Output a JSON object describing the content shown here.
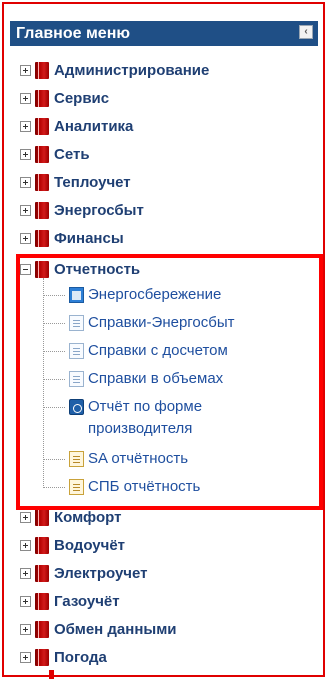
{
  "header": {
    "title": "Главное меню",
    "collapse_glyph": "‹"
  },
  "menu": {
    "items_top": [
      {
        "label": "Администрирование",
        "icon": "book-icon"
      },
      {
        "label": "Сервис",
        "icon": "book-icon"
      },
      {
        "label": "Аналитика",
        "icon": "book-icon"
      },
      {
        "label": "Сеть",
        "icon": "book-icon"
      },
      {
        "label": "Теплоучет",
        "icon": "book-icon"
      },
      {
        "label": "Энергосбыт",
        "icon": "book-icon"
      },
      {
        "label": "Финансы",
        "icon": "book-icon"
      }
    ],
    "expanded": {
      "label": "Отчетность",
      "children": [
        {
          "label": "Энергосбережение",
          "icon": "window-icon"
        },
        {
          "label": "Справки-Энергосбыт",
          "icon": "document-icon"
        },
        {
          "label": "Справки с досчетом",
          "icon": "document-icon"
        },
        {
          "label": "Справки в объемах",
          "icon": "document-icon"
        },
        {
          "label": "Отчёт по форме производителя",
          "icon": "report-gear-icon"
        },
        {
          "label": "SA отчётность",
          "icon": "spreadsheet-icon"
        },
        {
          "label": "СПБ отчётность",
          "icon": "spreadsheet-icon"
        }
      ]
    },
    "items_bottom": [
      {
        "label": "Комфорт",
        "icon": "book-icon"
      },
      {
        "label": "Водоучёт",
        "icon": "book-icon"
      },
      {
        "label": "Электроучет",
        "icon": "book-icon"
      },
      {
        "label": "Газоучёт",
        "icon": "book-icon"
      },
      {
        "label": "Обмен данными",
        "icon": "book-icon"
      },
      {
        "label": "Погода",
        "icon": "book-icon"
      }
    ]
  },
  "colors": {
    "header_bg": "#1f4f86",
    "highlight": "#ff0000",
    "link": "#1f4f9f",
    "item": "#1f3f73"
  }
}
